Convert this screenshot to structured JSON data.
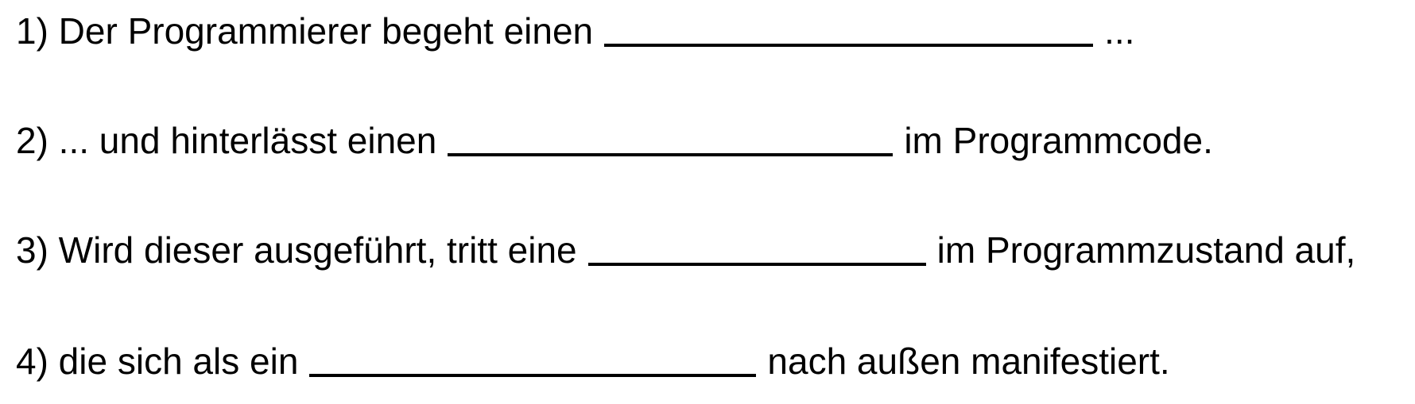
{
  "sentences": [
    {
      "before": "1) Der Programmierer begeht einen",
      "after": "..."
    },
    {
      "before": "2) ... und hinterlässt einen",
      "after": "im Programmcode."
    },
    {
      "before": "3) Wird dieser ausgeführt, tritt eine",
      "after": "im Programmzustand auf,"
    },
    {
      "before": "4) die sich als ein",
      "after": "nach außen manifestiert."
    }
  ]
}
